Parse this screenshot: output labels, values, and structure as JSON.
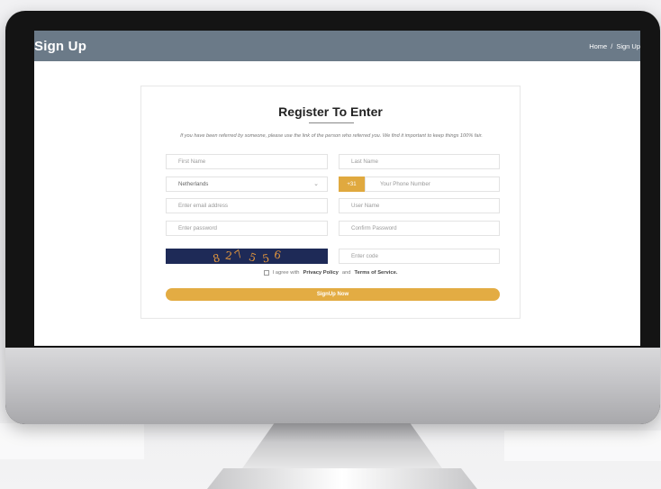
{
  "header": {
    "page_title": "Sign Up",
    "breadcrumb_home": "Home",
    "breadcrumb_sep": "/",
    "breadcrumb_current": "Sign Up",
    "color": "#6b7a88"
  },
  "form": {
    "title": "Register To Enter",
    "intro": "If you have been referred by someone, please use the link of the person who referred you. We find it important to keep things 100% fair.",
    "first_name_placeholder": "First Name",
    "last_name_placeholder": "Last Name",
    "country_value": "Netherlands",
    "country_code": "+31",
    "phone_placeholder": "Your Phone Number",
    "email_placeholder": "Enter email address",
    "username_placeholder": "User Name",
    "password_placeholder": "Enter password",
    "confirm_password_placeholder": "Confirm Password",
    "captcha_chars": [
      "8",
      "2",
      "7",
      "5",
      "5",
      "6"
    ],
    "code_placeholder": "Enter code",
    "agree_prefix": "I agree with",
    "privacy_link": "Privacy Policy",
    "agree_and": "and",
    "terms_link": "Terms of Service.",
    "submit_label": "SignUp Now",
    "accent_color": "#e3ac43"
  }
}
